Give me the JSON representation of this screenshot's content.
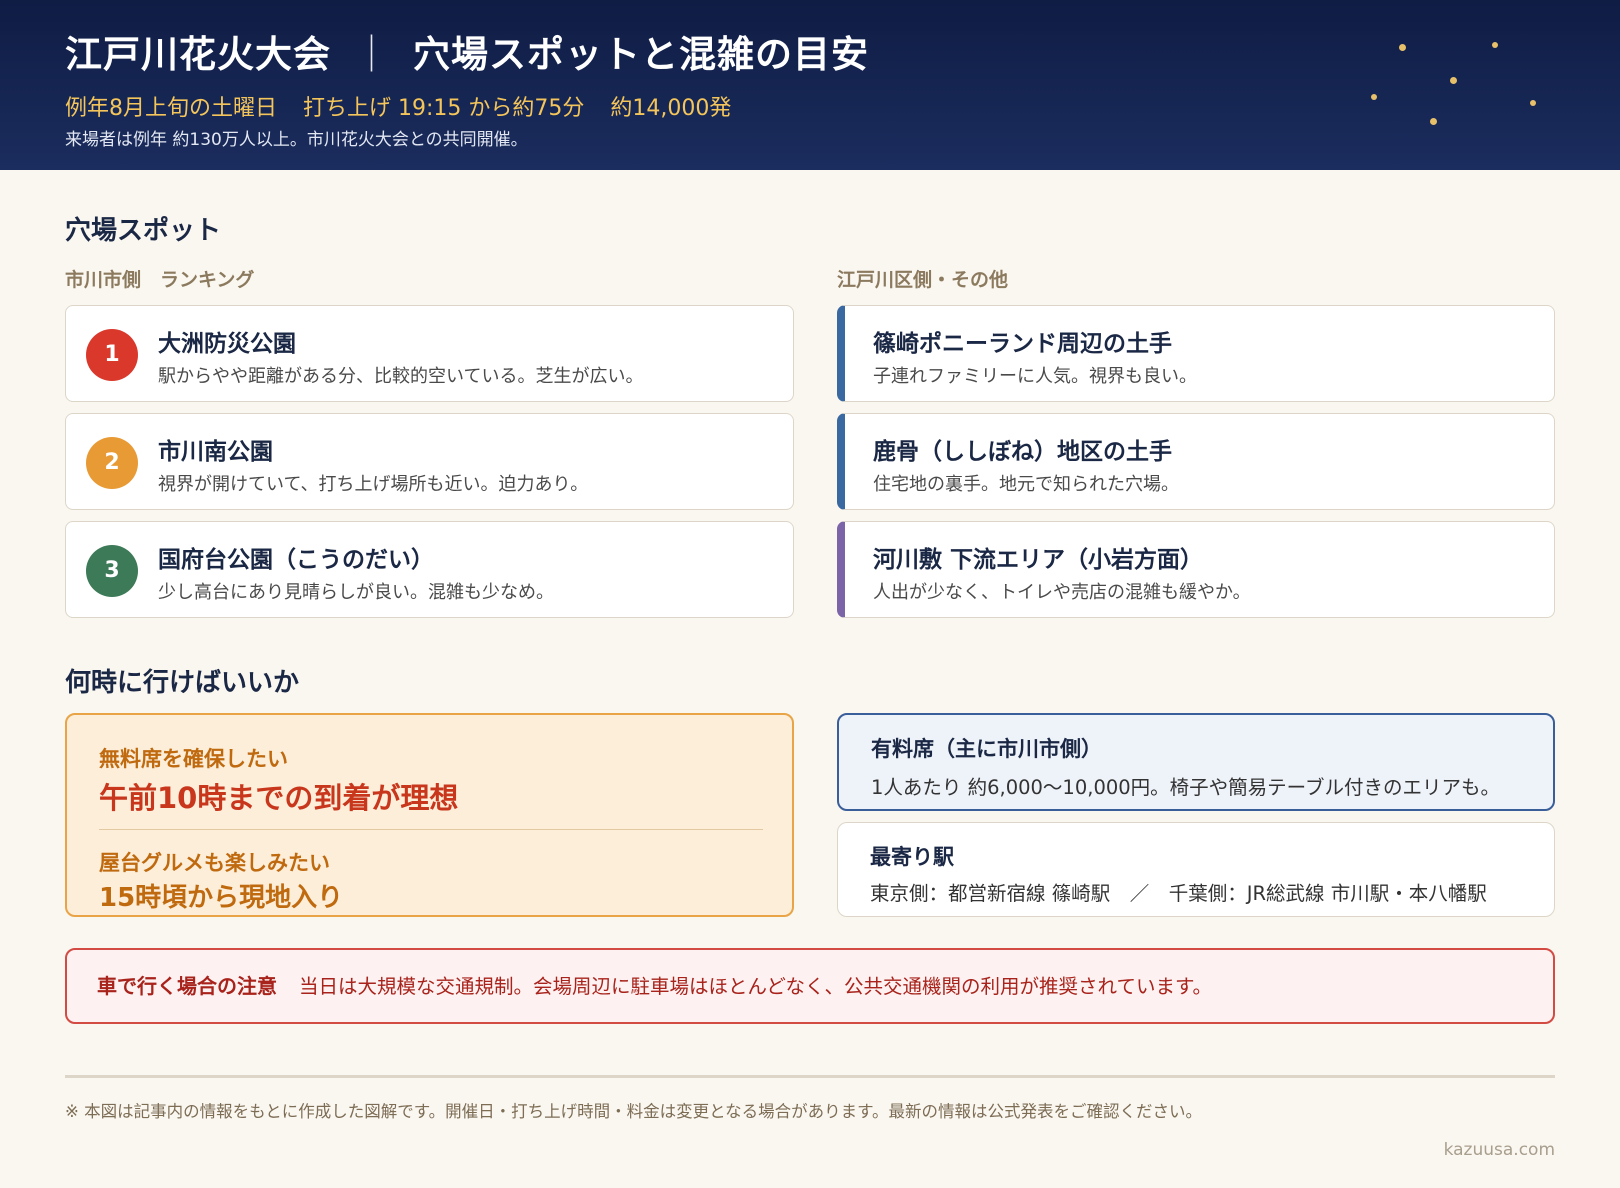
{
  "header": {
    "title_main": "江戸川花火大会",
    "title_sep": "｜",
    "title_sub": "穴場スポットと混雑の目安",
    "facts": [
      "例年8月上旬の土曜日",
      "打ち上げ 19:15 から約75分",
      "約14,000発"
    ],
    "note": "来場者は例年 約130万人以上。市川花火大会との共同開催。"
  },
  "spots": {
    "title": "穴場スポット",
    "left_label": "市川市側　ランキング",
    "right_label": "江戸川区側・その他",
    "ranking": [
      {
        "rank": "1",
        "name": "大洲防災公園",
        "desc": "駅からやや距離がある分、比較的空いている。芝生が広い。",
        "color": "#d9382b"
      },
      {
        "rank": "2",
        "name": "市川南公園",
        "desc": "視界が開けていて、打ち上げ場所も近い。迫力あり。",
        "color": "#e89a35"
      },
      {
        "rank": "3",
        "name": "国府台公園（こうのだい）",
        "desc": "少し高台にあり見晴らしが良い。混雑も少なめ。",
        "color": "#3d7a57"
      }
    ],
    "others": [
      {
        "name": "篠崎ポニーランド周辺の土手",
        "desc": "子連れファミリーに人気。視界も良い。",
        "color": "#3a68a0"
      },
      {
        "name": "鹿骨（ししぼね）地区の土手",
        "desc": "住宅地の裏手。地元で知られた穴場。",
        "color": "#3a68a0"
      },
      {
        "name": "河川敷 下流エリア（小岩方面）",
        "desc": "人出が少なく、トイレや売店の混雑も緩やか。",
        "color": "#7b64a8"
      }
    ]
  },
  "timing": {
    "title": "何時に行けばいいか",
    "free_label": "無料席を確保したい",
    "free_value": "午前10時までの到着が理想",
    "food_label": "屋台グルメも楽しみたい",
    "food_value": "15時頃から現地入り",
    "paid_title": "有料席（主に市川市側）",
    "paid_desc": "1人あたり 約6,000〜10,000円。椅子や簡易テーブル付きのエリアも。",
    "station_title": "最寄り駅",
    "station_desc": "東京側：都営新宿線 篠崎駅　／　千葉側：JR総武線 市川駅・本八幡駅"
  },
  "warning": {
    "label": "車で行く場合の注意",
    "text": "当日は大規模な交通規制。会場周辺に駐車場はほとんどなく、公共交通機関の利用が推奨されています。"
  },
  "footer": {
    "note": "※ 本図は記事内の情報をもとに作成した図解です。開催日・打ち上げ時間・料金は変更となる場合があります。最新の情報は公式発表をご確認ください。",
    "credit": "kazuusa.com"
  }
}
